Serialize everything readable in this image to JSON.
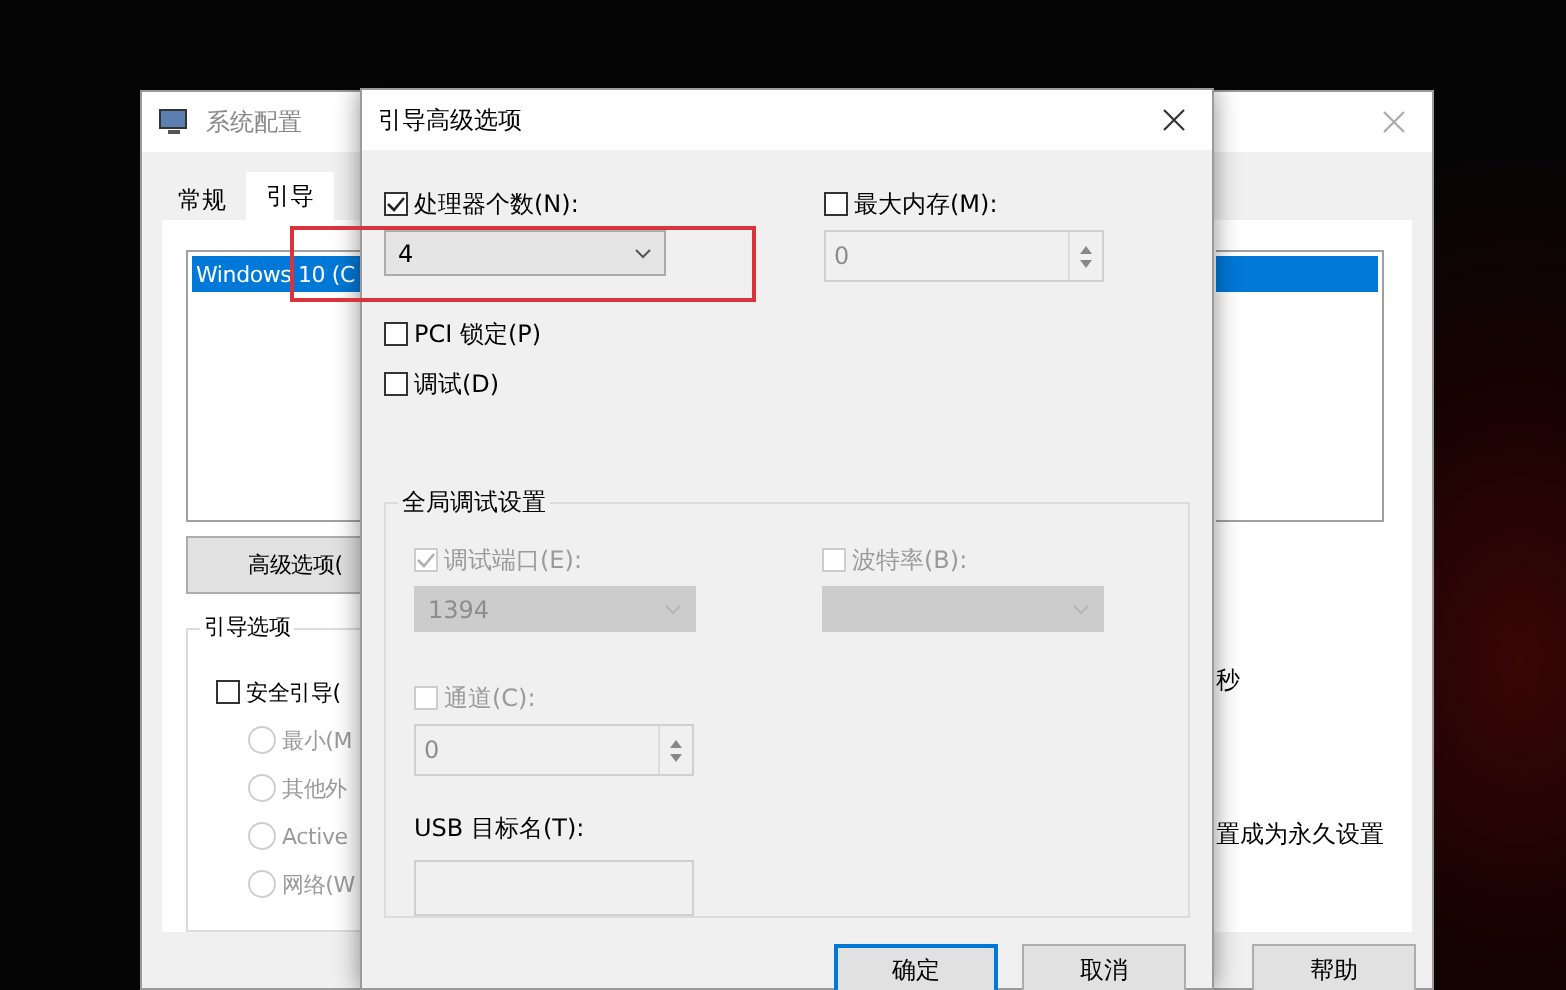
{
  "background_window": {
    "title": "系统配置",
    "tabs": [
      {
        "label": "常规",
        "selected": false
      },
      {
        "label": "引导",
        "selected": true
      }
    ],
    "boot_list": [
      {
        "label": "Windows 10 (C",
        "selected": true
      }
    ],
    "advanced_button": "高级选项(",
    "boot_options": {
      "title": "引导选项",
      "safe_boot": {
        "label": "安全引导(",
        "checked": false
      },
      "radios": [
        {
          "label": "最小(M",
          "selected": false
        },
        {
          "label": "其他外",
          "selected": false
        },
        {
          "label": "Active",
          "selected": false
        },
        {
          "label": "网络(W",
          "selected": false
        }
      ]
    },
    "timeout_text": "秒",
    "permanent_text": "置成为永久设置",
    "buttons": [
      "帮助"
    ]
  },
  "dialog": {
    "title": "引导高级选项",
    "processor_count": {
      "label": "处理器个数(N):",
      "checked": true,
      "value": "4"
    },
    "max_memory": {
      "label": "最大内存(M):",
      "checked": false,
      "value": "0"
    },
    "pci_lock": {
      "label": "PCI 锁定(P)",
      "checked": false
    },
    "debug": {
      "label": "调试(D)",
      "checked": false
    },
    "debug_settings": {
      "title": "全局调试设置",
      "debug_port": {
        "label": "调试端口(E):",
        "checked": true,
        "disabled": true,
        "value": "1394"
      },
      "baud_rate": {
        "label": "波特率(B):",
        "checked": false,
        "disabled": true
      },
      "channel": {
        "label": "通道(C):",
        "checked": false,
        "disabled": true,
        "value": "0"
      },
      "usb_target": {
        "label": "USB 目标名(T):"
      }
    },
    "buttons": [
      {
        "label": "确定",
        "focused": true
      },
      {
        "label": "取消",
        "focused": false
      }
    ]
  }
}
